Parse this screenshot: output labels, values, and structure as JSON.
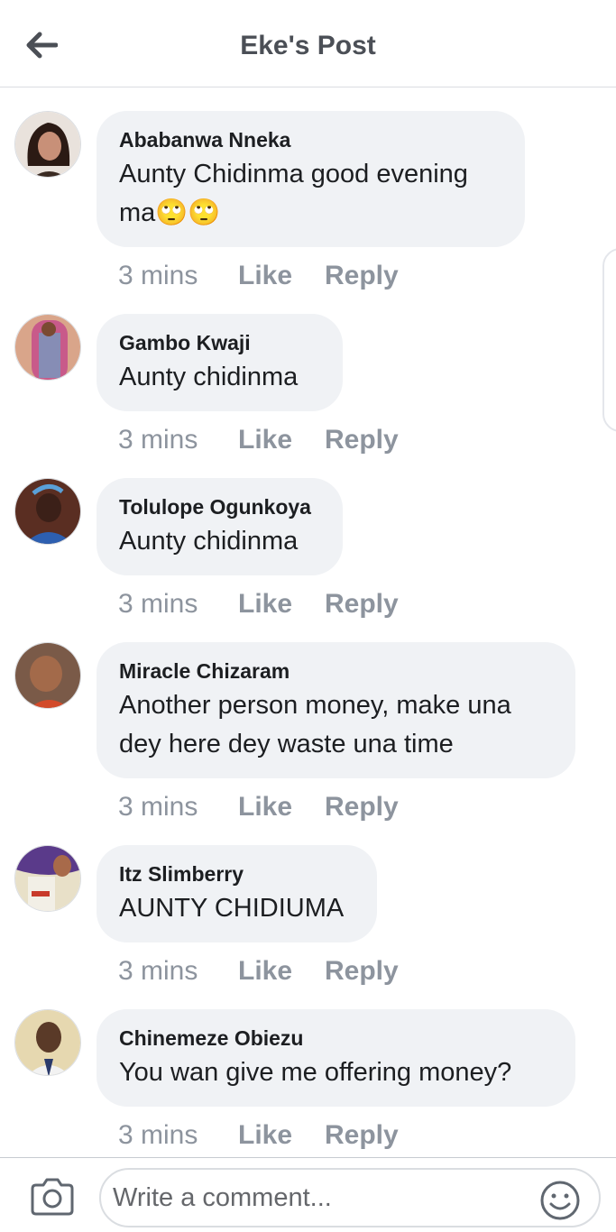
{
  "header": {
    "title": "Eke's Post",
    "back_icon": "arrow-left-icon"
  },
  "comments": [
    {
      "author": "Ababanwa Nneka",
      "text": "Aunty Chidinma good evening ma🙄🙄",
      "time": "3 mins",
      "like": "Like",
      "reply": "Reply"
    },
    {
      "author": "Gambo Kwaji",
      "text": "Aunty chidinma",
      "time": "3 mins",
      "like": "Like",
      "reply": "Reply"
    },
    {
      "author": "Tolulope Ogunkoya",
      "text": "Aunty chidinma",
      "time": "3 mins",
      "like": "Like",
      "reply": "Reply"
    },
    {
      "author": "Miracle Chizaram",
      "text": "Another person money, make una dey here dey waste una time",
      "time": "3 mins",
      "like": "Like",
      "reply": "Reply"
    },
    {
      "author": "Itz Slimberry",
      "text": "AUNTY CHIDIUMA",
      "time": "3 mins",
      "like": "Like",
      "reply": "Reply"
    },
    {
      "author": "Chinemeze Obiezu",
      "text": "You wan give me offering money?",
      "time": "3 mins",
      "like": "Like",
      "reply": "Reply"
    }
  ],
  "composer": {
    "placeholder": "Write a comment...",
    "camera_icon": "camera-icon",
    "emoji_icon": "smiley-icon"
  },
  "colors": {
    "bubble": "#f0f2f5",
    "muted_text": "#8d949e",
    "title_text": "#4b4f56"
  }
}
